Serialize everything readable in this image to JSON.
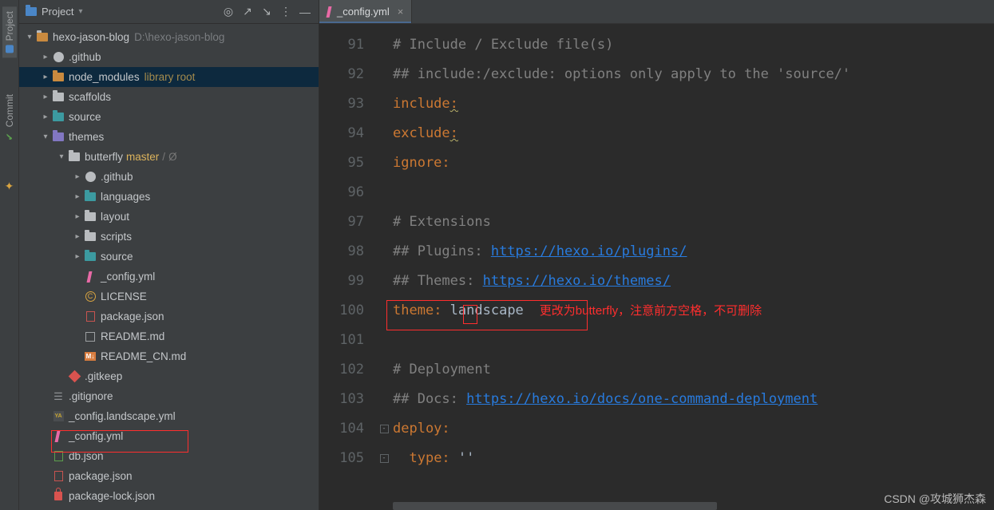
{
  "vtabs": {
    "project": "Project",
    "commit": "Commit"
  },
  "sidebar": {
    "title": "Project",
    "icons": {
      "target": "◎",
      "expand": "↗",
      "collapse": "↘",
      "more": "⋮",
      "minimize": "—"
    }
  },
  "tree": {
    "root": {
      "name": "hexo-jason-blog",
      "path": "D:\\hexo-jason-blog"
    },
    "nodes": [
      {
        "d": 1,
        "exp": true,
        "icon": "gh",
        "label": ".github"
      },
      {
        "d": 1,
        "exp": true,
        "icon": "orange",
        "label": "node_modules",
        "lib": "library root",
        "hl": true
      },
      {
        "d": 1,
        "exp": true,
        "icon": "folder",
        "label": "scaffolds"
      },
      {
        "d": 1,
        "exp": true,
        "icon": "teal",
        "label": "source"
      },
      {
        "d": 1,
        "exp": "down",
        "icon": "purple",
        "label": "themes"
      },
      {
        "d": 2,
        "exp": "down",
        "icon": "folder",
        "label": "butterfly",
        "branch": "master",
        "sym": "Ø"
      },
      {
        "d": 3,
        "exp": true,
        "icon": "gh",
        "label": ".github"
      },
      {
        "d": 3,
        "exp": true,
        "icon": "teal",
        "label": "languages"
      },
      {
        "d": 3,
        "exp": true,
        "icon": "folder",
        "label": "layout"
      },
      {
        "d": 3,
        "exp": true,
        "icon": "folder",
        "label": "scripts"
      },
      {
        "d": 3,
        "exp": true,
        "icon": "teal",
        "label": "source"
      },
      {
        "d": 3,
        "icon": "pink",
        "label": "_config.yml"
      },
      {
        "d": 3,
        "icon": "lic",
        "label": "LICENSE"
      },
      {
        "d": 3,
        "icon": "json",
        "label": "package.json"
      },
      {
        "d": 3,
        "icon": "md",
        "label": "README.md"
      },
      {
        "d": 3,
        "icon": "mdcn",
        "label": "README_CN.md"
      },
      {
        "d": 2,
        "icon": "diamond",
        "label": ".gitkeep"
      },
      {
        "d": 1,
        "icon": "txt",
        "label": ".gitignore"
      },
      {
        "d": 1,
        "icon": "yaml",
        "label": "_config.landscape.yml"
      },
      {
        "d": 1,
        "icon": "pink",
        "label": "_config.yml",
        "boxed": true
      },
      {
        "d": 1,
        "icon": "jsong",
        "label": "db.json"
      },
      {
        "d": 1,
        "icon": "json",
        "label": "package.json"
      },
      {
        "d": 1,
        "icon": "lock",
        "label": "package-lock.json"
      }
    ]
  },
  "tab": {
    "title": "_config.yml",
    "close": "×"
  },
  "code": {
    "start": 91,
    "lines": [
      {
        "t": "comment",
        "text": "# Include / Exclude file(s)"
      },
      {
        "t": "comment",
        "text": "## include:/exclude: options only apply to the 'source/'"
      },
      {
        "t": "kv",
        "key": "include",
        "wavy": true
      },
      {
        "t": "kv",
        "key": "exclude",
        "wavy": true
      },
      {
        "t": "kv",
        "key": "ignore"
      },
      {
        "t": "blank"
      },
      {
        "t": "comment",
        "text": "# Extensions"
      },
      {
        "t": "commentlink",
        "pre": "## Plugins: ",
        "url": "https://hexo.io/plugins/"
      },
      {
        "t": "commentlink",
        "pre": "## Themes: ",
        "url": "https://hexo.io/themes/"
      },
      {
        "t": "kv",
        "key": "theme",
        "val": "landscape",
        "boxed": true,
        "annot": "更改为butterfly，注意前方空格，不可删除"
      },
      {
        "t": "blank"
      },
      {
        "t": "comment",
        "text": "# Deployment"
      },
      {
        "t": "commentlink",
        "pre": "## Docs: ",
        "url": "https://hexo.io/docs/one-command-deployment"
      },
      {
        "t": "kv",
        "key": "deploy",
        "fold": "-"
      },
      {
        "t": "kvindent",
        "key": "type",
        "val": "''",
        "fold": "-"
      }
    ]
  },
  "watermark": "CSDN @攻城狮杰森"
}
